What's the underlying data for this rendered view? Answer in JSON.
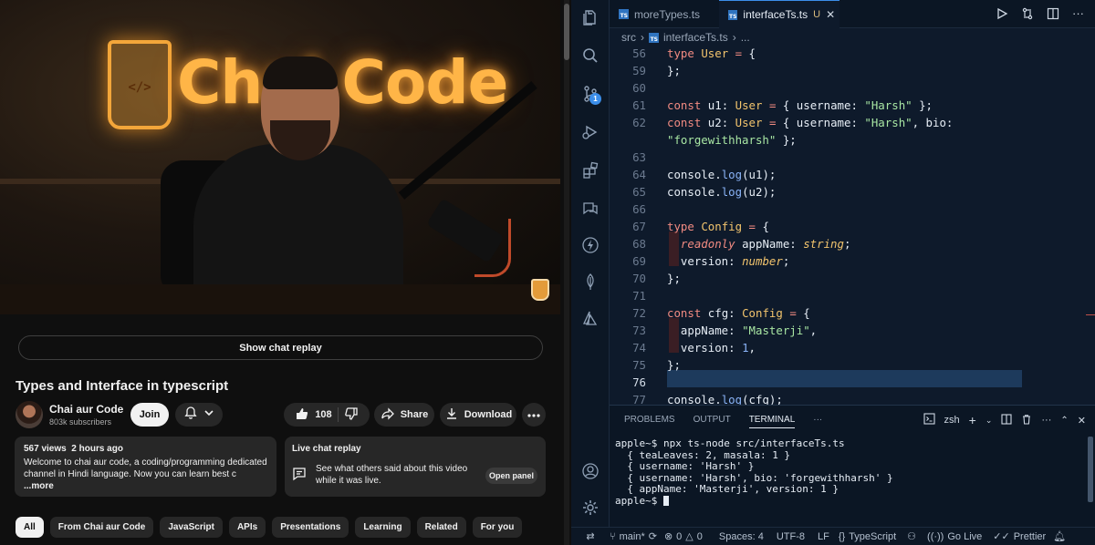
{
  "youtube": {
    "chat_replay_button": "Show chat replay",
    "video_title": "Types and Interface in typescript",
    "channel": {
      "name": "Chai aur Code",
      "subscribers": "803k subscribers",
      "join_label": "Join"
    },
    "actions": {
      "likes": "108",
      "share": "Share",
      "download": "Download"
    },
    "description": {
      "views": "567 views",
      "age": "2 hours ago",
      "text": "Welcome to chai aur code, a coding/programming dedicated channel in Hindi language. Now you can learn best c",
      "more": "...more"
    },
    "live_chat": {
      "title": "Live chat replay",
      "text": "See what others said about this video while it was live.",
      "button": "Open panel"
    },
    "chips": [
      "All",
      "From Chai aur Code",
      "JavaScript",
      "APIs",
      "Presentations",
      "Learning",
      "Related",
      "For you"
    ],
    "thumbnail_brand": "Chai Code",
    "thumbnail_glass": "</>"
  },
  "vscode": {
    "tabs": [
      {
        "label": "moreTypes.ts"
      },
      {
        "label": "interfaceTs.ts",
        "modifier": "U"
      }
    ],
    "breadcrumb": [
      "src",
      "interfaceTs.ts",
      "..."
    ],
    "line_numbers": [
      "56",
      "59",
      "60",
      "61",
      "62",
      "",
      "63",
      "64",
      "65",
      "66",
      "67",
      "68",
      "69",
      "70",
      "71",
      "72",
      "73",
      "74",
      "75",
      "76",
      "77"
    ],
    "scm_badge": "1",
    "panel": {
      "tabs": [
        "PROBLEMS",
        "OUTPUT",
        "TERMINAL"
      ],
      "shell": "zsh"
    },
    "terminal_lines": [
      "apple~$ npx ts-node src/interfaceTs.ts",
      "{ teaLeaves: 2, masala: 1 }",
      "{ username: 'Harsh' }",
      "{ username: 'Harsh', bio: 'forgewithharsh' }",
      "{ appName: 'Masterji', version: 1 }",
      "apple~$ "
    ],
    "status": {
      "branch": "main*",
      "errors": "0",
      "warnings": "0",
      "spaces": "Spaces: 4",
      "encoding": "UTF-8",
      "eol": "LF",
      "language": "TypeScript",
      "golive": "Go Live",
      "prettier": "Prettier"
    }
  },
  "colors": {
    "accent": "#3b8eea",
    "keyword": "#f28b82",
    "type": "#f2c46d",
    "string": "#a8e6a3"
  }
}
